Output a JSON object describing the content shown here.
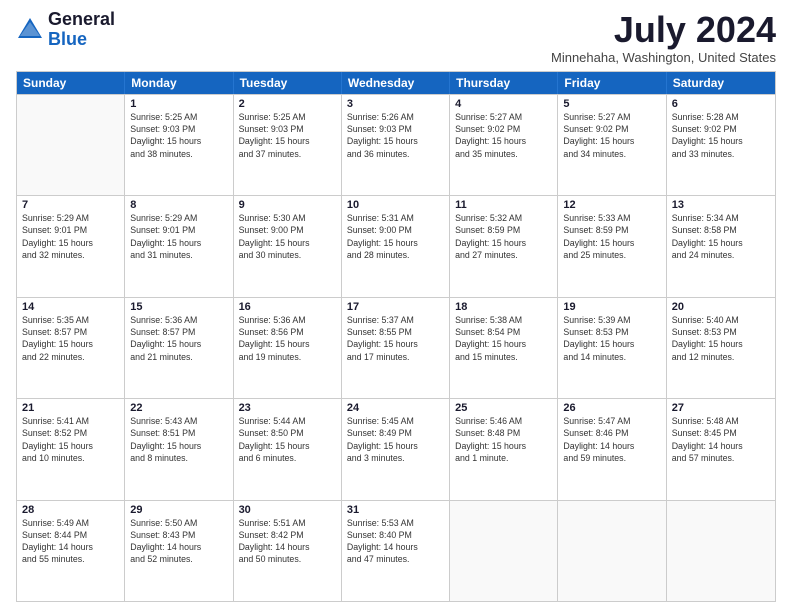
{
  "logo": {
    "general": "General",
    "blue": "Blue"
  },
  "header": {
    "month": "July 2024",
    "location": "Minnehaha, Washington, United States"
  },
  "days_of_week": [
    "Sunday",
    "Monday",
    "Tuesday",
    "Wednesday",
    "Thursday",
    "Friday",
    "Saturday"
  ],
  "weeks": [
    [
      {
        "day": "",
        "info": ""
      },
      {
        "day": "1",
        "info": "Sunrise: 5:25 AM\nSunset: 9:03 PM\nDaylight: 15 hours\nand 38 minutes."
      },
      {
        "day": "2",
        "info": "Sunrise: 5:25 AM\nSunset: 9:03 PM\nDaylight: 15 hours\nand 37 minutes."
      },
      {
        "day": "3",
        "info": "Sunrise: 5:26 AM\nSunset: 9:03 PM\nDaylight: 15 hours\nand 36 minutes."
      },
      {
        "day": "4",
        "info": "Sunrise: 5:27 AM\nSunset: 9:02 PM\nDaylight: 15 hours\nand 35 minutes."
      },
      {
        "day": "5",
        "info": "Sunrise: 5:27 AM\nSunset: 9:02 PM\nDaylight: 15 hours\nand 34 minutes."
      },
      {
        "day": "6",
        "info": "Sunrise: 5:28 AM\nSunset: 9:02 PM\nDaylight: 15 hours\nand 33 minutes."
      }
    ],
    [
      {
        "day": "7",
        "info": "Sunrise: 5:29 AM\nSunset: 9:01 PM\nDaylight: 15 hours\nand 32 minutes."
      },
      {
        "day": "8",
        "info": "Sunrise: 5:29 AM\nSunset: 9:01 PM\nDaylight: 15 hours\nand 31 minutes."
      },
      {
        "day": "9",
        "info": "Sunrise: 5:30 AM\nSunset: 9:00 PM\nDaylight: 15 hours\nand 30 minutes."
      },
      {
        "day": "10",
        "info": "Sunrise: 5:31 AM\nSunset: 9:00 PM\nDaylight: 15 hours\nand 28 minutes."
      },
      {
        "day": "11",
        "info": "Sunrise: 5:32 AM\nSunset: 8:59 PM\nDaylight: 15 hours\nand 27 minutes."
      },
      {
        "day": "12",
        "info": "Sunrise: 5:33 AM\nSunset: 8:59 PM\nDaylight: 15 hours\nand 25 minutes."
      },
      {
        "day": "13",
        "info": "Sunrise: 5:34 AM\nSunset: 8:58 PM\nDaylight: 15 hours\nand 24 minutes."
      }
    ],
    [
      {
        "day": "14",
        "info": "Sunrise: 5:35 AM\nSunset: 8:57 PM\nDaylight: 15 hours\nand 22 minutes."
      },
      {
        "day": "15",
        "info": "Sunrise: 5:36 AM\nSunset: 8:57 PM\nDaylight: 15 hours\nand 21 minutes."
      },
      {
        "day": "16",
        "info": "Sunrise: 5:36 AM\nSunset: 8:56 PM\nDaylight: 15 hours\nand 19 minutes."
      },
      {
        "day": "17",
        "info": "Sunrise: 5:37 AM\nSunset: 8:55 PM\nDaylight: 15 hours\nand 17 minutes."
      },
      {
        "day": "18",
        "info": "Sunrise: 5:38 AM\nSunset: 8:54 PM\nDaylight: 15 hours\nand 15 minutes."
      },
      {
        "day": "19",
        "info": "Sunrise: 5:39 AM\nSunset: 8:53 PM\nDaylight: 15 hours\nand 14 minutes."
      },
      {
        "day": "20",
        "info": "Sunrise: 5:40 AM\nSunset: 8:53 PM\nDaylight: 15 hours\nand 12 minutes."
      }
    ],
    [
      {
        "day": "21",
        "info": "Sunrise: 5:41 AM\nSunset: 8:52 PM\nDaylight: 15 hours\nand 10 minutes."
      },
      {
        "day": "22",
        "info": "Sunrise: 5:43 AM\nSunset: 8:51 PM\nDaylight: 15 hours\nand 8 minutes."
      },
      {
        "day": "23",
        "info": "Sunrise: 5:44 AM\nSunset: 8:50 PM\nDaylight: 15 hours\nand 6 minutes."
      },
      {
        "day": "24",
        "info": "Sunrise: 5:45 AM\nSunset: 8:49 PM\nDaylight: 15 hours\nand 3 minutes."
      },
      {
        "day": "25",
        "info": "Sunrise: 5:46 AM\nSunset: 8:48 PM\nDaylight: 15 hours\nand 1 minute."
      },
      {
        "day": "26",
        "info": "Sunrise: 5:47 AM\nSunset: 8:46 PM\nDaylight: 14 hours\nand 59 minutes."
      },
      {
        "day": "27",
        "info": "Sunrise: 5:48 AM\nSunset: 8:45 PM\nDaylight: 14 hours\nand 57 minutes."
      }
    ],
    [
      {
        "day": "28",
        "info": "Sunrise: 5:49 AM\nSunset: 8:44 PM\nDaylight: 14 hours\nand 55 minutes."
      },
      {
        "day": "29",
        "info": "Sunrise: 5:50 AM\nSunset: 8:43 PM\nDaylight: 14 hours\nand 52 minutes."
      },
      {
        "day": "30",
        "info": "Sunrise: 5:51 AM\nSunset: 8:42 PM\nDaylight: 14 hours\nand 50 minutes."
      },
      {
        "day": "31",
        "info": "Sunrise: 5:53 AM\nSunset: 8:40 PM\nDaylight: 14 hours\nand 47 minutes."
      },
      {
        "day": "",
        "info": ""
      },
      {
        "day": "",
        "info": ""
      },
      {
        "day": "",
        "info": ""
      }
    ]
  ]
}
